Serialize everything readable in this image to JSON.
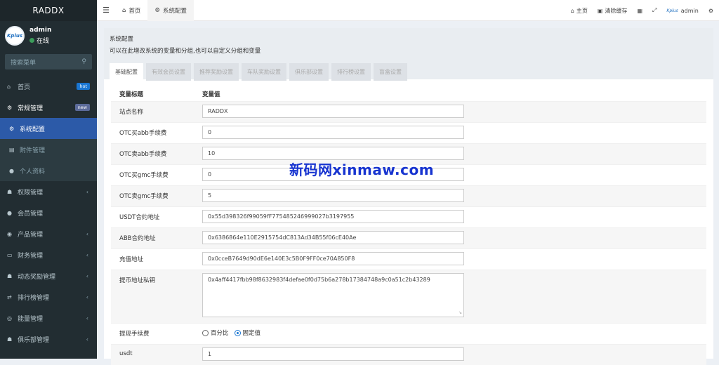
{
  "brand": "RADDX",
  "user": {
    "name": "admin",
    "status": "在线",
    "avatar_text": "Kplus"
  },
  "search": {
    "placeholder": "搜索菜单"
  },
  "menu": [
    {
      "label": "首页",
      "icon": "dashboard-icon",
      "glyph": "⌂",
      "badge": "hot"
    },
    {
      "label": "常规管理",
      "icon": "cogs-icon",
      "glyph": "⚙",
      "badge": "new"
    },
    {
      "label": "系统配置",
      "icon": "gear-icon",
      "glyph": "⚙",
      "active": true
    },
    {
      "label": "附件管理",
      "icon": "file-icon",
      "glyph": "▤"
    },
    {
      "label": "个人资料",
      "icon": "user-icon",
      "glyph": "●"
    },
    {
      "label": "权限管理",
      "icon": "group-icon",
      "glyph": "☗"
    },
    {
      "label": "会员管理",
      "icon": "user-icon",
      "glyph": "●"
    },
    {
      "label": "产品管理",
      "icon": "product-icon",
      "glyph": "◉"
    },
    {
      "label": "财务管理",
      "icon": "card-icon",
      "glyph": "▭"
    },
    {
      "label": "动态奖励管理",
      "icon": "users-icon",
      "glyph": "☗"
    },
    {
      "label": "排行榜管理",
      "icon": "shuffle-icon",
      "glyph": "⇄"
    },
    {
      "label": "能量管理",
      "icon": "energy-icon",
      "glyph": "◎"
    },
    {
      "label": "俱乐部管理",
      "icon": "users-icon",
      "glyph": "☗"
    }
  ],
  "topbar": {
    "home_tab": "首页",
    "config_tab": "系统配置",
    "home_link": "主页",
    "clear_cache": "清除缓存",
    "admin": "admin"
  },
  "panel": {
    "title": "系统配置",
    "desc": "可以在此增改系统的变量和分组,也可以自定义分组和变量",
    "tabs": [
      "基础配置",
      "有效会员设置",
      "推荐奖励设置",
      "车队奖励设置",
      "俱乐部设置",
      "排行榜设置",
      "盲盒设置"
    ]
  },
  "table": {
    "col_title": "变量标题",
    "col_value": "变量值",
    "rows": [
      {
        "label": "站点名称",
        "value": "RADDX"
      },
      {
        "label": "OTC买abb手续费",
        "value": "0"
      },
      {
        "label": "OTC卖abb手续费",
        "value": "10"
      },
      {
        "label": "OTC买gmc手续费",
        "value": "0"
      },
      {
        "label": "OTC卖gmc手续费",
        "value": "5"
      },
      {
        "label": "USDT合约地址",
        "value": "0x55d398326f99059fF775485246999027b3197955"
      },
      {
        "label": "ABB合约地址",
        "value": "0x6386864e110E2915754dC813Ad34B55f06cE40Ae"
      },
      {
        "label": "充值地址",
        "value": "0x0cceB7649d90dE6e140E3c5B0F9FF0ce70A850F8"
      },
      {
        "label": "提币地址私钥",
        "value": "0x4aff4417fbb98f8632983f4defae0f0d75b6a278b17384748a9c0a51c2b43289"
      },
      {
        "label": "提现手续费",
        "radio1": "百分比",
        "radio2": "固定值"
      },
      {
        "label": "usdt",
        "value": "1"
      }
    ]
  },
  "watermark": "新码网xinmaw.com"
}
